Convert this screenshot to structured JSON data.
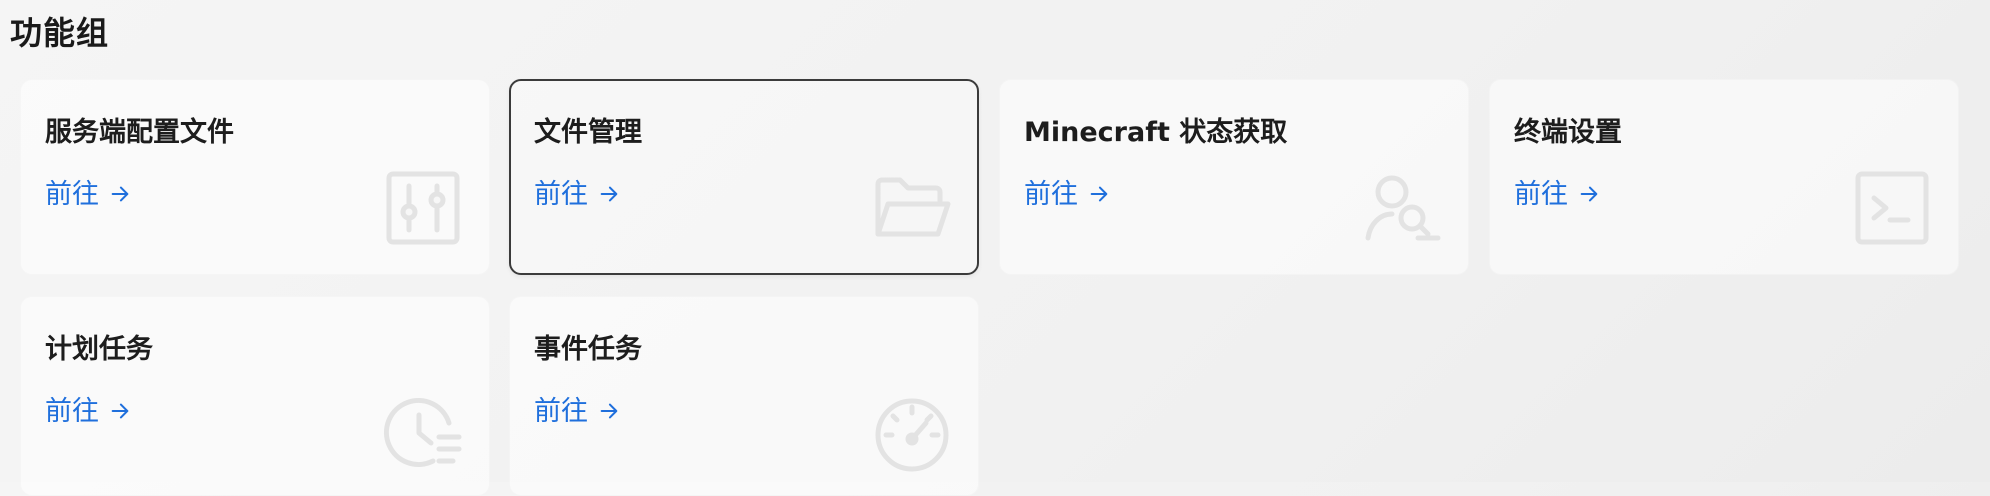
{
  "section": {
    "title": "功能组"
  },
  "cards": [
    {
      "title": "服务端配置文件",
      "link_label": "前往",
      "icon": "sliders-icon",
      "selected": false
    },
    {
      "title": "文件管理",
      "link_label": "前往",
      "icon": "folder-open-icon",
      "selected": true
    },
    {
      "title": "Minecraft 状态获取",
      "link_label": "前往",
      "icon": "user-search-icon",
      "selected": false
    },
    {
      "title": "终端设置",
      "link_label": "前往",
      "icon": "terminal-icon",
      "selected": false
    },
    {
      "title": "计划任务",
      "link_label": "前往",
      "icon": "clock-list-icon",
      "selected": false
    },
    {
      "title": "事件任务",
      "link_label": "前往",
      "icon": "speedometer-icon",
      "selected": false
    }
  ],
  "colors": {
    "link": "#1f6fdc",
    "icon_watermark": "#e3e3e3",
    "selected_border": "#3b3b3b"
  }
}
